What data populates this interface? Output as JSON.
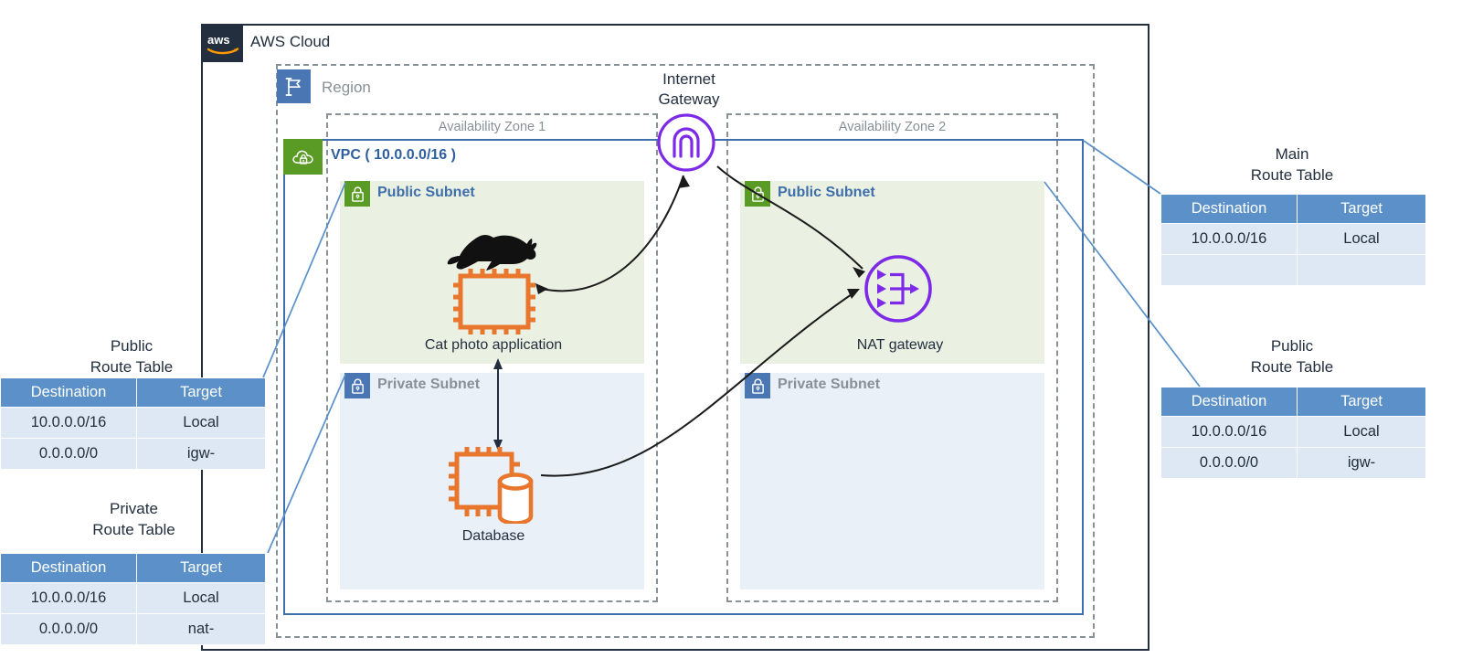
{
  "cloud": {
    "label": "AWS Cloud",
    "logo_icon": "aws-logo-icon"
  },
  "region": {
    "label": "Region",
    "icon": "region-flag-icon"
  },
  "vpc": {
    "label": "VPC  ( 10.0.0.0/16 )",
    "icon": "vpc-cloud-lock-icon",
    "cidr": "10.0.0.0/16"
  },
  "availability_zones": [
    {
      "label": "Availability Zone 1"
    },
    {
      "label": "Availability Zone 2"
    }
  ],
  "subnets": {
    "az1_public": {
      "label": "Public Subnet",
      "icon": "lock-icon"
    },
    "az1_private": {
      "label": "Private Subnet",
      "icon": "lock-icon"
    },
    "az2_public": {
      "label": "Public Subnet",
      "icon": "lock-icon"
    },
    "az2_private": {
      "label": "Private Subnet",
      "icon": "lock-icon"
    }
  },
  "nodes": {
    "internet_gateway": {
      "label": "Internet\nGateway",
      "line1": "Internet",
      "line2": "Gateway",
      "icon": "internet-gateway-icon"
    },
    "cat_photo_application": {
      "label": "Cat photo application",
      "icon": "ec2-instance-icon"
    },
    "database": {
      "label": "Database",
      "icon": "database-instance-icon"
    },
    "nat_gateway": {
      "label": "NAT gateway",
      "icon": "nat-gateway-icon"
    }
  },
  "route_tables": [
    {
      "id": "public-left",
      "title_line1": "Public",
      "title_line2": "Route Table",
      "headers": [
        "Destination",
        "Target"
      ],
      "rows": [
        [
          "10.0.0.0/16",
          "Local"
        ],
        [
          "0.0.0.0/0",
          "igw-"
        ]
      ]
    },
    {
      "id": "private-left",
      "title_line1": "Private",
      "title_line2": "Route Table",
      "headers": [
        "Destination",
        "Target"
      ],
      "rows": [
        [
          "10.0.0.0/16",
          "Local"
        ],
        [
          "0.0.0.0/0",
          "nat-"
        ]
      ]
    },
    {
      "id": "main-right",
      "title_line1": "Main",
      "title_line2": "Route Table",
      "headers": [
        "Destination",
        "Target"
      ],
      "rows": [
        [
          "10.0.0.0/16",
          "Local"
        ],
        [
          "",
          ""
        ]
      ]
    },
    {
      "id": "public-right",
      "title_line1": "Public",
      "title_line2": "Route Table",
      "headers": [
        "Destination",
        "Target"
      ],
      "rows": [
        [
          "10.0.0.0/16",
          "Local"
        ],
        [
          "0.0.0.0/0",
          "igw-"
        ]
      ]
    }
  ],
  "colors": {
    "aws_navy": "#232f3e",
    "region_blue": "#4a77b4",
    "vpc_green": "#5a9b25",
    "vpc_border": "#3f6fab",
    "public_subnet_fill": "#eaf0e2",
    "private_subnet_fill": "#e9f0f8",
    "table_header_blue": "#5b90c8",
    "table_row_blue": "#dde8f4",
    "purple": "#7d2ae8",
    "orange": "#e8762c",
    "gray_label": "#879196",
    "connector_blue": "#5b90c8"
  }
}
